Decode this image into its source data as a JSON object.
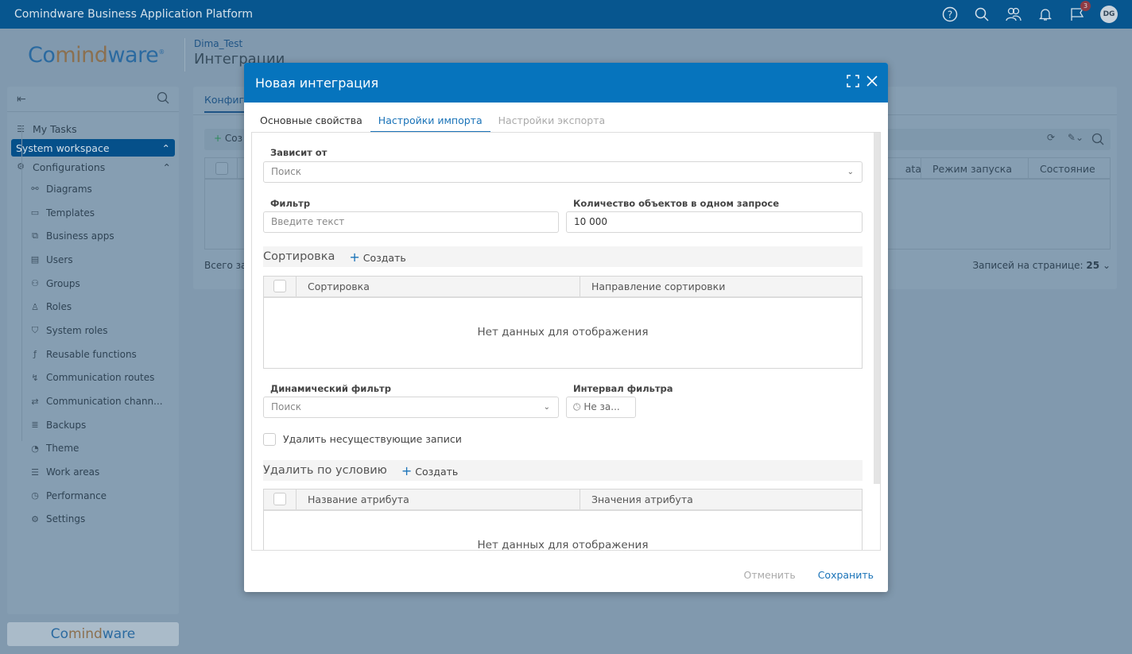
{
  "app": {
    "title": "Comindware Business Application Platform",
    "notifications_count": "3",
    "avatar_initials": "DG",
    "logo": "Comindware"
  },
  "breadcrumb": {
    "workspace": "Dima_Test",
    "page": "Интеграции"
  },
  "sidebar": {
    "my_tasks": "My Tasks",
    "workspace": "System workspace",
    "configurations": "Configurations",
    "items": [
      {
        "label": "Diagrams",
        "icon": "diagram-icon"
      },
      {
        "label": "Templates",
        "icon": "briefcase-icon"
      },
      {
        "label": "Business apps",
        "icon": "cubes-icon"
      },
      {
        "label": "Users",
        "icon": "id-card-icon"
      },
      {
        "label": "Groups",
        "icon": "group-icon"
      },
      {
        "label": "Roles",
        "icon": "role-icon"
      },
      {
        "label": "System roles",
        "icon": "shield-icon"
      },
      {
        "label": "Reusable functions",
        "icon": "function-icon"
      },
      {
        "label": "Communication routes",
        "icon": "route-icon"
      },
      {
        "label": "Communication chann...",
        "icon": "arrows-icon"
      },
      {
        "label": "Backups",
        "icon": "database-icon"
      },
      {
        "label": "Theme",
        "icon": "palette-icon"
      },
      {
        "label": "Work areas",
        "icon": "list-icon"
      },
      {
        "label": "Performance",
        "icon": "gauge-icon"
      },
      {
        "label": "Settings",
        "icon": "gear-icon"
      }
    ],
    "footer_logo": "Comindware"
  },
  "main": {
    "tab": "Конфигу",
    "create": "Соз",
    "columns": [
      "ata",
      "Режим запуска",
      "Состояние"
    ],
    "total": "Всего за",
    "per_page_label": "Записей на странице:",
    "per_page_value": "25"
  },
  "modal": {
    "title": "Новая интеграция",
    "tabs": [
      {
        "label": "Основные свойства",
        "state": "normal"
      },
      {
        "label": "Настройки импорта",
        "state": "active"
      },
      {
        "label": "Настройки экспорта",
        "state": "disabled"
      }
    ],
    "depends_on": {
      "label": "Зависит от",
      "placeholder": "Поиск"
    },
    "filter": {
      "label": "Фильтр",
      "placeholder": "Введите текст"
    },
    "batch": {
      "label": "Количество объектов в одном запросе",
      "value": "10 000"
    },
    "sorting": {
      "title": "Сортировка",
      "create": "Создать",
      "columns": [
        "Сортировка",
        "Направление сортировки"
      ],
      "empty": "Нет данных для отображения"
    },
    "dynamic_filter": {
      "label": "Динамический фильтр",
      "placeholder": "Поиск"
    },
    "interval": {
      "label": "Интервал фильтра",
      "value": "Не за..."
    },
    "delete_missing": {
      "label": "Удалить несуществующие записи",
      "checked": false
    },
    "delete_by": {
      "title": "Удалить по условию",
      "create": "Создать",
      "columns": [
        "Название атрибута",
        "Значения атрибута"
      ],
      "empty": "Нет данных для отображения"
    },
    "cancel": "Отменить",
    "save": "Сохранить"
  },
  "colors": {
    "topbar": "#07568f",
    "modal_header": "#0674bd",
    "accent": "#1a73b8"
  }
}
